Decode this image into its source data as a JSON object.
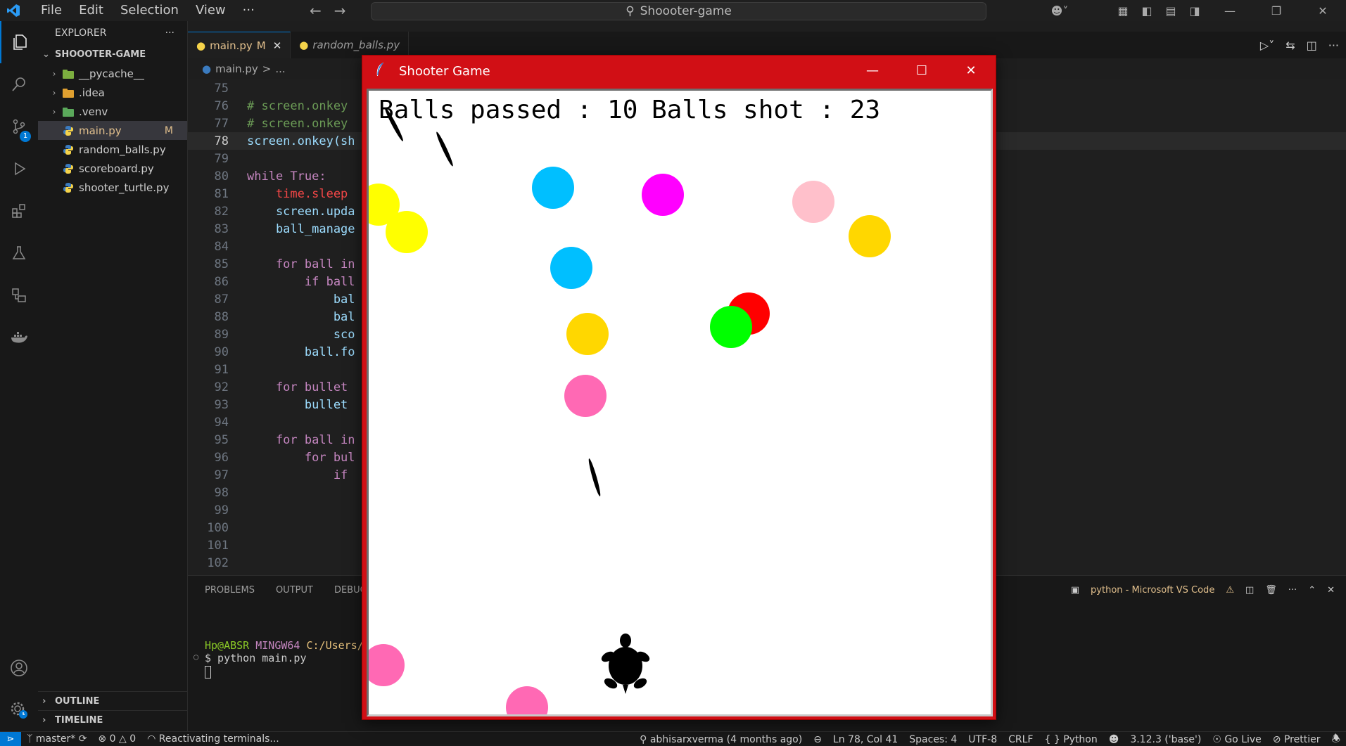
{
  "menu": [
    "File",
    "Edit",
    "Selection",
    "View",
    "···"
  ],
  "search": {
    "text": "Shoooter-game"
  },
  "sidebar": {
    "header": "EXPLORER",
    "project": "SHOOOTER-GAME",
    "items": [
      {
        "label": "__pycache__",
        "type": "folder"
      },
      {
        "label": ".idea",
        "type": "folder"
      },
      {
        "label": ".venv",
        "type": "folder"
      },
      {
        "label": "main.py",
        "type": "file",
        "modified": "M"
      },
      {
        "label": "random_balls.py",
        "type": "file"
      },
      {
        "label": "scoreboard.py",
        "type": "file"
      },
      {
        "label": "shooter_turtle.py",
        "type": "file"
      }
    ],
    "outline": "OUTLINE",
    "timeline": "TIMELINE"
  },
  "activity_badge": "1",
  "tabs": [
    {
      "label": "main.py",
      "modified": "M",
      "close": "✕"
    },
    {
      "label": "random_balls.py"
    }
  ],
  "breadcrumb": {
    "file": "main.py",
    "sep": ">",
    "rest": "..."
  },
  "code": {
    "lines": [
      {
        "n": "75",
        "text": ""
      },
      {
        "n": "76",
        "text": "# screen.onkey"
      },
      {
        "n": "77",
        "text": "# screen.onkey"
      },
      {
        "n": "78",
        "text": "screen.onkey(sh"
      },
      {
        "n": "79",
        "text": ""
      },
      {
        "n": "80",
        "text": "while True:"
      },
      {
        "n": "81",
        "text": "    time.sleep"
      },
      {
        "n": "82",
        "text": "    screen.upda"
      },
      {
        "n": "83",
        "text": "    ball_manage"
      },
      {
        "n": "84",
        "text": ""
      },
      {
        "n": "85",
        "text": "    for ball in"
      },
      {
        "n": "86",
        "text": "        if ball"
      },
      {
        "n": "87",
        "text": "            bal"
      },
      {
        "n": "88",
        "text": "            bal"
      },
      {
        "n": "89",
        "text": "            sco"
      },
      {
        "n": "90",
        "text": "        ball.fo"
      },
      {
        "n": "91",
        "text": ""
      },
      {
        "n": "92",
        "text": "    for bullet"
      },
      {
        "n": "93",
        "text": "        bullet"
      },
      {
        "n": "94",
        "text": ""
      },
      {
        "n": "95",
        "text": "    for ball in"
      },
      {
        "n": "96",
        "text": "        for bul"
      },
      {
        "n": "97",
        "text": "            if"
      },
      {
        "n": "98",
        "text": ""
      },
      {
        "n": "99",
        "text": ""
      },
      {
        "n": "100",
        "text": ""
      },
      {
        "n": "101",
        "text": ""
      },
      {
        "n": "102",
        "text": ""
      }
    ]
  },
  "panel": {
    "tabs": [
      "PROBLEMS",
      "OUTPUT",
      "DEBUG"
    ],
    "terminal_title": "python - Microsoft VS Code",
    "prompt_user": "Hp@ABSR",
    "prompt_env": "MINGW64",
    "prompt_path": "C:/Users/",
    "command": "$ python main.py"
  },
  "statusbar": {
    "branch": "master*",
    "errors": "0",
    "warnings": "0",
    "task": "Reactivating terminals...",
    "blame": "abhisarxverma (4 months ago)",
    "position": "Ln 78, Col 41",
    "spaces": "Spaces: 4",
    "encoding": "UTF-8",
    "eol": "CRLF",
    "language": "Python",
    "interpreter": "3.12.3 ('base')",
    "golive": "Go Live",
    "prettier": "Prettier"
  },
  "game": {
    "title": "Shooter Game",
    "balls_passed_label": "Balls passed : 10",
    "balls_shot_label": "Balls shot : 23",
    "balls_passed": 10,
    "balls_shot": 23,
    "colors": {
      "yellow": "#ffff00",
      "gold": "#ffd700",
      "skyblue": "#00bfff",
      "magenta": "#ff00ff",
      "pink": "#ffc0cb",
      "hotpink": "#ff69b4",
      "red": "#ff0000",
      "green": "#00ff00",
      "titlebar": "#d10f15"
    }
  }
}
